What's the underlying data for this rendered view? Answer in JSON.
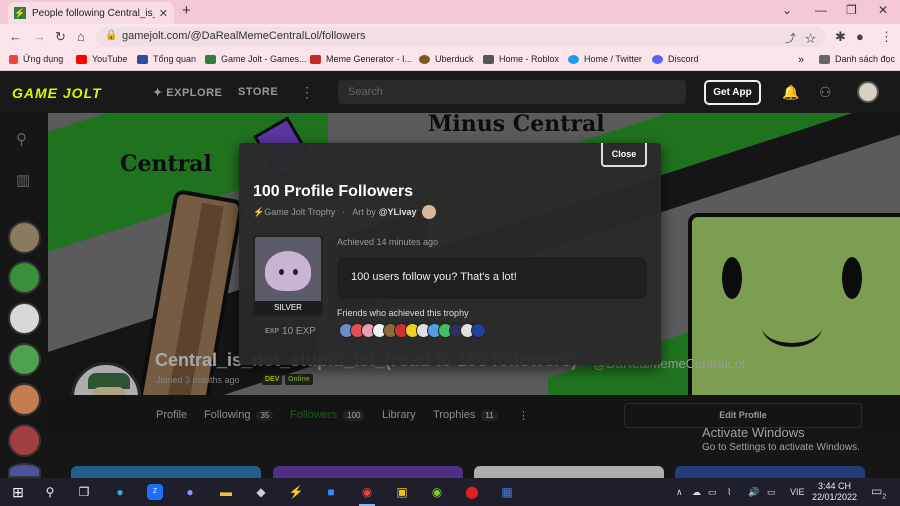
{
  "browser": {
    "tab_title": "People following Central_is_not_",
    "url": "gamejolt.com/@DaRealMemeCentralLol/followers",
    "bookmarks": [
      {
        "label": "Ứng dụng",
        "color": "#e44"
      },
      {
        "label": "YouTube",
        "color": "#f00"
      },
      {
        "label": "Tổng quan",
        "color": "#2a4fa0"
      },
      {
        "label": "Game Jolt - Games...",
        "color": "#2f7f3b"
      },
      {
        "label": "Meme Generator - I...",
        "color": "#c62828"
      },
      {
        "label": "Uberduck",
        "color": "#7a5a1c"
      },
      {
        "label": "Home - Roblox",
        "color": "#555"
      },
      {
        "label": "Home / Twitter",
        "color": "#1d9bf0"
      },
      {
        "label": "Discord",
        "color": "#5865f2"
      }
    ],
    "reading_list": "Danh sách đọc"
  },
  "gamejolt": {
    "logo": "GAME JOLT",
    "nav_explore": "EXPLORE",
    "nav_store": "STORE",
    "search_placeholder": "Search",
    "get_app": "Get App"
  },
  "banner": {
    "text_top": "Minus Central",
    "text_left": "Central"
  },
  "profile": {
    "display_name": "Central_is_not_stupid_lol_(road to 100 followers)",
    "handle": "@DaRealMemeCentralLol",
    "joined": "Joined 3 months ago",
    "badge_dev": "DEV",
    "badge_online": "Online",
    "tabs": [
      {
        "label": "Profile",
        "count": ""
      },
      {
        "label": "Following",
        "count": "35"
      },
      {
        "label": "Followers",
        "count": "100"
      },
      {
        "label": "Library",
        "count": ""
      },
      {
        "label": "Trophies",
        "count": "11"
      }
    ],
    "edit_profile": "Edit Profile"
  },
  "modal": {
    "close": "Close",
    "title": "100 Profile Followers",
    "trophy_type": "Game Jolt Trophy",
    "art_by": "Art by",
    "artist": "@YLivay",
    "tier": "SILVER",
    "exp_icon": "EXP",
    "exp": "10 EXP",
    "achieved": "Achieved 14 minutes ago",
    "description": "100 users follow you? That's a lot!",
    "friends_label": "Friends who achieved this trophy",
    "friend_colors": [
      "#6a8fc8",
      "#e05050",
      "#e8a0b0",
      "#f0f0f0",
      "#8a6a3a",
      "#d03030",
      "#f0d020",
      "#e0e0e0",
      "#50a0e0",
      "#40c060",
      "#303060",
      "#e0e0e0",
      "#2040a0"
    ]
  },
  "watermark": {
    "line1": "Activate Windows",
    "line2": "Go to Settings to activate Windows."
  },
  "taskbar": {
    "lang": "VIE",
    "time": "3:44 CH",
    "date": "22/01/2022",
    "notif": "2"
  }
}
